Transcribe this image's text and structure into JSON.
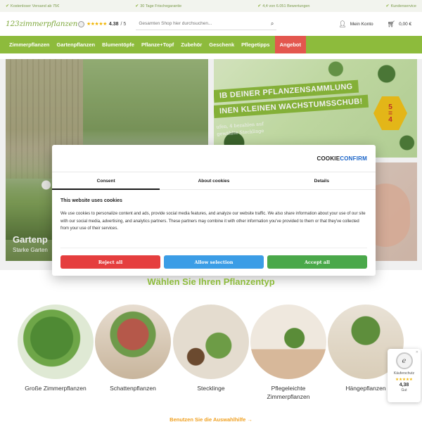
{
  "topbar": {
    "usps": [
      "Kostenloser Versand ab 75€",
      "30 Tage Frischegarantie",
      "4,4 von 6.051 Bewertungen",
      "Kundenservice"
    ]
  },
  "header": {
    "logo": "123zimmerpflanzen",
    "rating_value": "4.38",
    "rating_max": "/ 5",
    "stars": "★★★★★",
    "search_placeholder": "Gesamten Shop hier durchsuchen...",
    "account_label": "Mein Konto",
    "cart_label": "0,00 €"
  },
  "nav": {
    "items": [
      "Zimmerpflanzen",
      "Gartenpflanzen",
      "Blumentöpfe",
      "Pflanze+Topf",
      "Zubehör",
      "Geschenk",
      "Pflegetipps"
    ],
    "highlight": "Angebot"
  },
  "hero": {
    "title": "Gartenp",
    "subtitle": "Starke Garten"
  },
  "promo": {
    "line1": "IB DEINER PFLANZENSAMMLUNG",
    "line2": "INEN KLEINEN WACHSTUMSSCHUB!",
    "small1": "ufen, 4 bezahlen auf",
    "small2": "gewählte Stecklinge",
    "badge_top": "5",
    "badge_mid": "=",
    "badge_bottom": "4"
  },
  "cookie": {
    "logo_part1": "COOKIE",
    "logo_part2": "CONFIRM",
    "tabs": [
      "Consent",
      "About cookies",
      "Details"
    ],
    "heading": "This website uses cookies",
    "text": "We use cookies to personalize content and ads, provide social media features, and analyze our website traffic. We also share information about your use of our site with our social media, advertising, and analytics partners. These partners may combine it with other information you've provided to them or that they've collected from your use of their services.",
    "reject": "Reject all",
    "selection": "Allow selection",
    "accept": "Accept all"
  },
  "section": {
    "title": "Wählen Sie Ihren Pflanzentyp",
    "categories": [
      {
        "label": "Große Zimmerpflanzen"
      },
      {
        "label": "Schattenpflanzen"
      },
      {
        "label": "Stecklinge"
      },
      {
        "label": "Pflegeleichte Zimmerpflanzen"
      },
      {
        "label": "Hängepflanzen"
      }
    ],
    "bottom_link": "Benutzen Sie die Auswahlhilfe  →"
  },
  "trust": {
    "seal": "e",
    "label": "Käuferschutz",
    "stars": "★★★★★",
    "score": "4,38",
    "grade": "Gut"
  },
  "colors": {
    "brand_green": "#8dbb3c",
    "angebot_red": "#e3574e",
    "reject": "#e53e3e",
    "selection": "#3b9de6",
    "accept": "#4aa84a"
  }
}
